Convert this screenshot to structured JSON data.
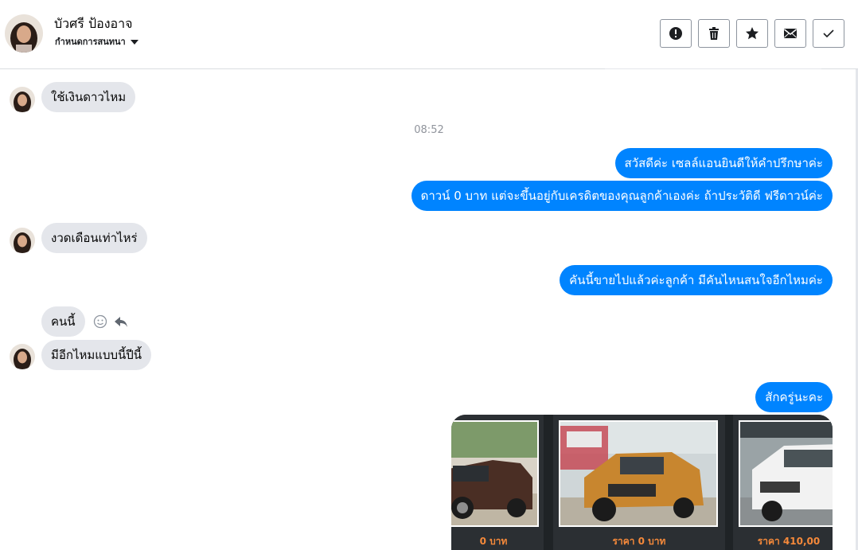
{
  "header": {
    "contact_name": "บัวศรี ป้องอาจ",
    "subtitle": "กำหนดการสนทนา",
    "actions": [
      {
        "name": "report-button",
        "icon": "exclamation-circle-icon"
      },
      {
        "name": "delete-button",
        "icon": "trash-icon"
      },
      {
        "name": "star-button",
        "icon": "star-icon"
      },
      {
        "name": "mark-unread-button",
        "icon": "envelope-icon"
      },
      {
        "name": "mark-done-button",
        "icon": "check-icon"
      }
    ]
  },
  "messages": {
    "in_1": "ใช้เงินดาวไหม",
    "timestamp": "08:52",
    "out_1": "สวัสดีค่ะ เซลล์แอนยินดีให้คำปรึกษาค่ะ",
    "out_2": "ดาวน์ 0 บาท แต่จะขึ้นอยู่กับเครดิตของคุณลูกค้าเองค่ะ ถ้าประวัติดี ฟรีดาวน์ค่ะ",
    "in_2": "งวดเดือนเท่าไหร่",
    "out_3": "คันนี้ขายไปแล้วค่ะลูกค้า มีคันไหนสนใจอีกไหมค่ะ",
    "in_3": "คนนี้",
    "in_4": "มีอีกไหมแบบนี้ปีนี้",
    "out_4": "สักครู่นะคะ"
  },
  "gallery": {
    "captions": [
      "0 บาท",
      "ราคา 0 บาท",
      "ราคา 410,00"
    ]
  },
  "colors": {
    "outgoing_bubble": "#0084ff",
    "incoming_bubble": "#e4e6eb",
    "caption_orange": "#f5893a"
  }
}
